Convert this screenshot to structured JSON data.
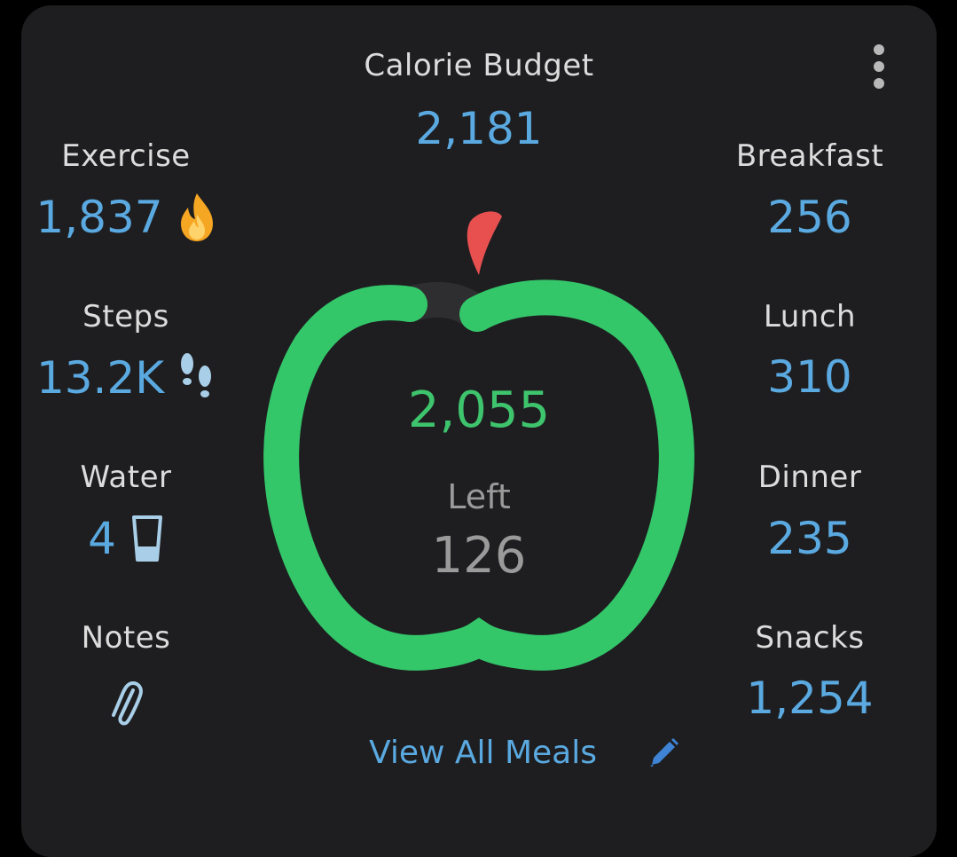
{
  "header": {
    "title": "Calorie Budget",
    "budget": "2,181",
    "menu_icon": "more-vert-icon"
  },
  "left": {
    "exercise": {
      "label": "Exercise",
      "value": "1,837",
      "icon": "fire-icon"
    },
    "steps": {
      "label": "Steps",
      "value": "13.2K",
      "icon": "footprints-icon"
    },
    "water": {
      "label": "Water",
      "value": "4",
      "icon": "water-glass-icon"
    },
    "notes": {
      "label": "Notes",
      "icon": "paperclip-icon"
    }
  },
  "right": {
    "breakfast": {
      "label": "Breakfast",
      "value": "256"
    },
    "lunch": {
      "label": "Lunch",
      "value": "310"
    },
    "dinner": {
      "label": "Dinner",
      "value": "235"
    },
    "snacks": {
      "label": "Snacks",
      "value": "1,254"
    }
  },
  "center": {
    "consumed": "2,055",
    "left_label": "Left",
    "left_value": "126",
    "progress_fraction": 0.942
  },
  "footer": {
    "link_label": "View All Meals",
    "edit_icon": "pencil-icon"
  },
  "colors": {
    "card_bg": "#1e1e20",
    "accent_blue": "#5aa9e0",
    "ring_green": "#34c76a",
    "ring_track": "#2e2e30",
    "stem_red": "#e85050",
    "fire_orange": "#f5a623"
  }
}
